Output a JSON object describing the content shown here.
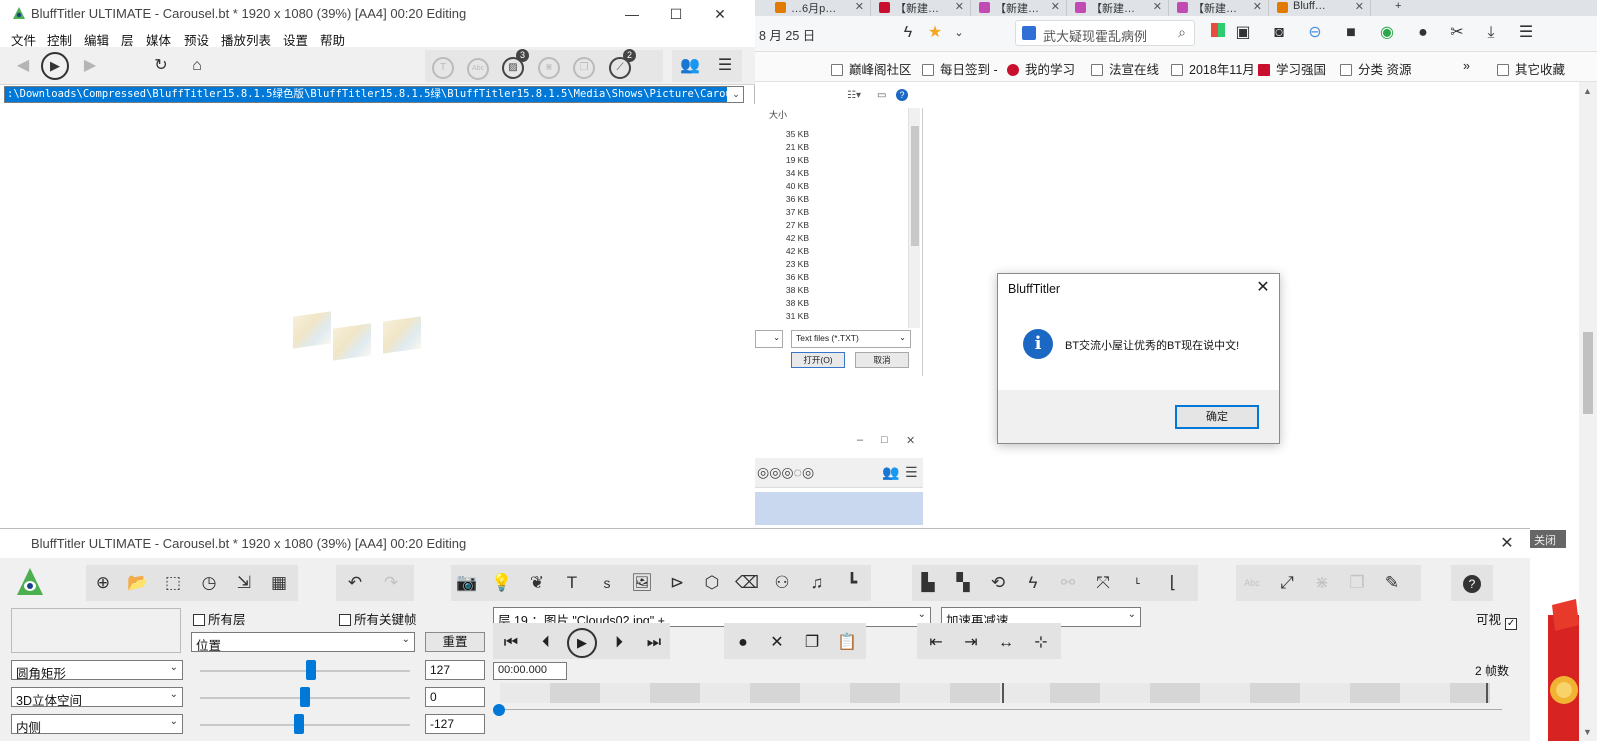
{
  "browser": {
    "tabs": [
      {
        "label": "…6月p…",
        "color": "#e07b00"
      },
      {
        "label": "【新建…",
        "color": "#c8102e"
      },
      {
        "label": "【新建…",
        "color": "#c24ab3"
      },
      {
        "label": "【新建…",
        "color": "#c24ab3"
      },
      {
        "label": "【新建…",
        "color": "#c24ab3"
      },
      {
        "label": "Bluff…",
        "color": "#e07b00"
      }
    ],
    "address_fragment": "8 月 25 日",
    "search_placeholder": "武大疑现霍乱病例",
    "bookmarks": [
      {
        "label": "巅峰阁社区",
        "icon": "page-icon"
      },
      {
        "label": "每日签到 -",
        "icon": "page-icon"
      },
      {
        "label": "我的学习",
        "icon": "red-circle-icon"
      },
      {
        "label": "法宣在线",
        "icon": "page-icon"
      },
      {
        "label": "2018年11月",
        "icon": "page-icon"
      },
      {
        "label": "学习强国",
        "icon": "red-square-icon"
      },
      {
        "label": "分类 资源",
        "icon": "page-icon"
      }
    ],
    "bookmarks_more": "»",
    "other_bookmarks": "其它收藏"
  },
  "file_dialog": {
    "size_header": "大小",
    "sizes": [
      "35 KB",
      "21 KB",
      "19 KB",
      "34 KB",
      "40 KB",
      "36 KB",
      "37 KB",
      "27 KB",
      "42 KB",
      "42 KB",
      "23 KB",
      "36 KB",
      "38 KB",
      "38 KB",
      "31 KB"
    ],
    "filter": "Text files (*.TXT)",
    "open_label": "打开(O)",
    "cancel_label": "取消"
  },
  "alert": {
    "title": "BluffTitler",
    "message": "BT交流小屋让优秀的BT现在说中文!",
    "ok_label": "确定",
    "close_glyph": "✕"
  },
  "main_window": {
    "title": "BluffTitler ULTIMATE  - Carousel.bt * 1920 x 1080 (39%) [AA4] 00:20 Editing",
    "menu": [
      "文件",
      "控制",
      "编辑",
      "层",
      "媒体",
      "预设",
      "播放列表",
      "设置",
      "帮助"
    ],
    "path": ":\\Downloads\\Compressed\\BluffTitler15.8.1.5绿色版\\BluffTitler15.8.1.5绿\\BluffTitler15.8.1.5\\Media\\Shows\\Picture\\Carousel.bt",
    "badge_media": "3",
    "badge_tools": "2",
    "minimize_glyph": "—",
    "maximize_glyph": "☐",
    "close_glyph": "✕"
  },
  "mini_window": {
    "minimize_glyph": "–",
    "maximize_glyph": "□",
    "close_glyph": "✕"
  },
  "control_window": {
    "title": "BluffTitler ULTIMATE  - Carousel.bt * 1920 x 1080 (39%) [AA4] 00:20 Editing",
    "close_glyph": "✕",
    "close_overlay": "关闭",
    "all_layers_label": "所有层",
    "all_keyframes_label": "所有关键帧",
    "property_select": "位置",
    "reset_label": "重置",
    "layer_select": "层    19   ：图片 \"Clouds02.jpg\" +",
    "easing_select": "加速再减速",
    "visible_label": "可视",
    "rows": [
      {
        "select": "圆角矩形",
        "value": "127",
        "pos": 0.53
      },
      {
        "select": "3D立体空间",
        "value": "0",
        "pos": 0.5
      },
      {
        "select": "内侧",
        "value": "-127",
        "pos": 0.47
      }
    ],
    "time": "00:00.000",
    "frames_label": "2 帧数"
  }
}
